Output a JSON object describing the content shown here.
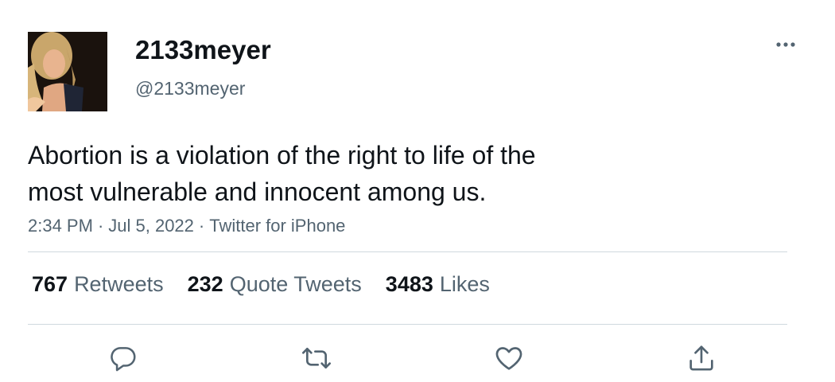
{
  "user": {
    "display_name": "2133meyer",
    "handle": "@2133meyer"
  },
  "tweet": {
    "text_line1": "Abortion is a violation of the right to life of the",
    "text_line2": "most vulnerable and innocent among us.",
    "time": "2:34 PM",
    "date": "Jul 5, 2022",
    "separator": "·",
    "source": "Twitter for iPhone"
  },
  "stats": {
    "retweets_count": "767",
    "retweets_label": "Retweets",
    "quotes_count": "232",
    "quotes_label": "Quote Tweets",
    "likes_count": "3483",
    "likes_label": "Likes"
  },
  "icons": {
    "more": "more-dots-icon",
    "reply": "reply-icon",
    "retweet": "retweet-icon",
    "like": "heart-icon",
    "share": "share-icon"
  },
  "colors": {
    "text_primary": "#0f1419",
    "text_secondary": "#536471",
    "divider": "#cfd9de"
  }
}
